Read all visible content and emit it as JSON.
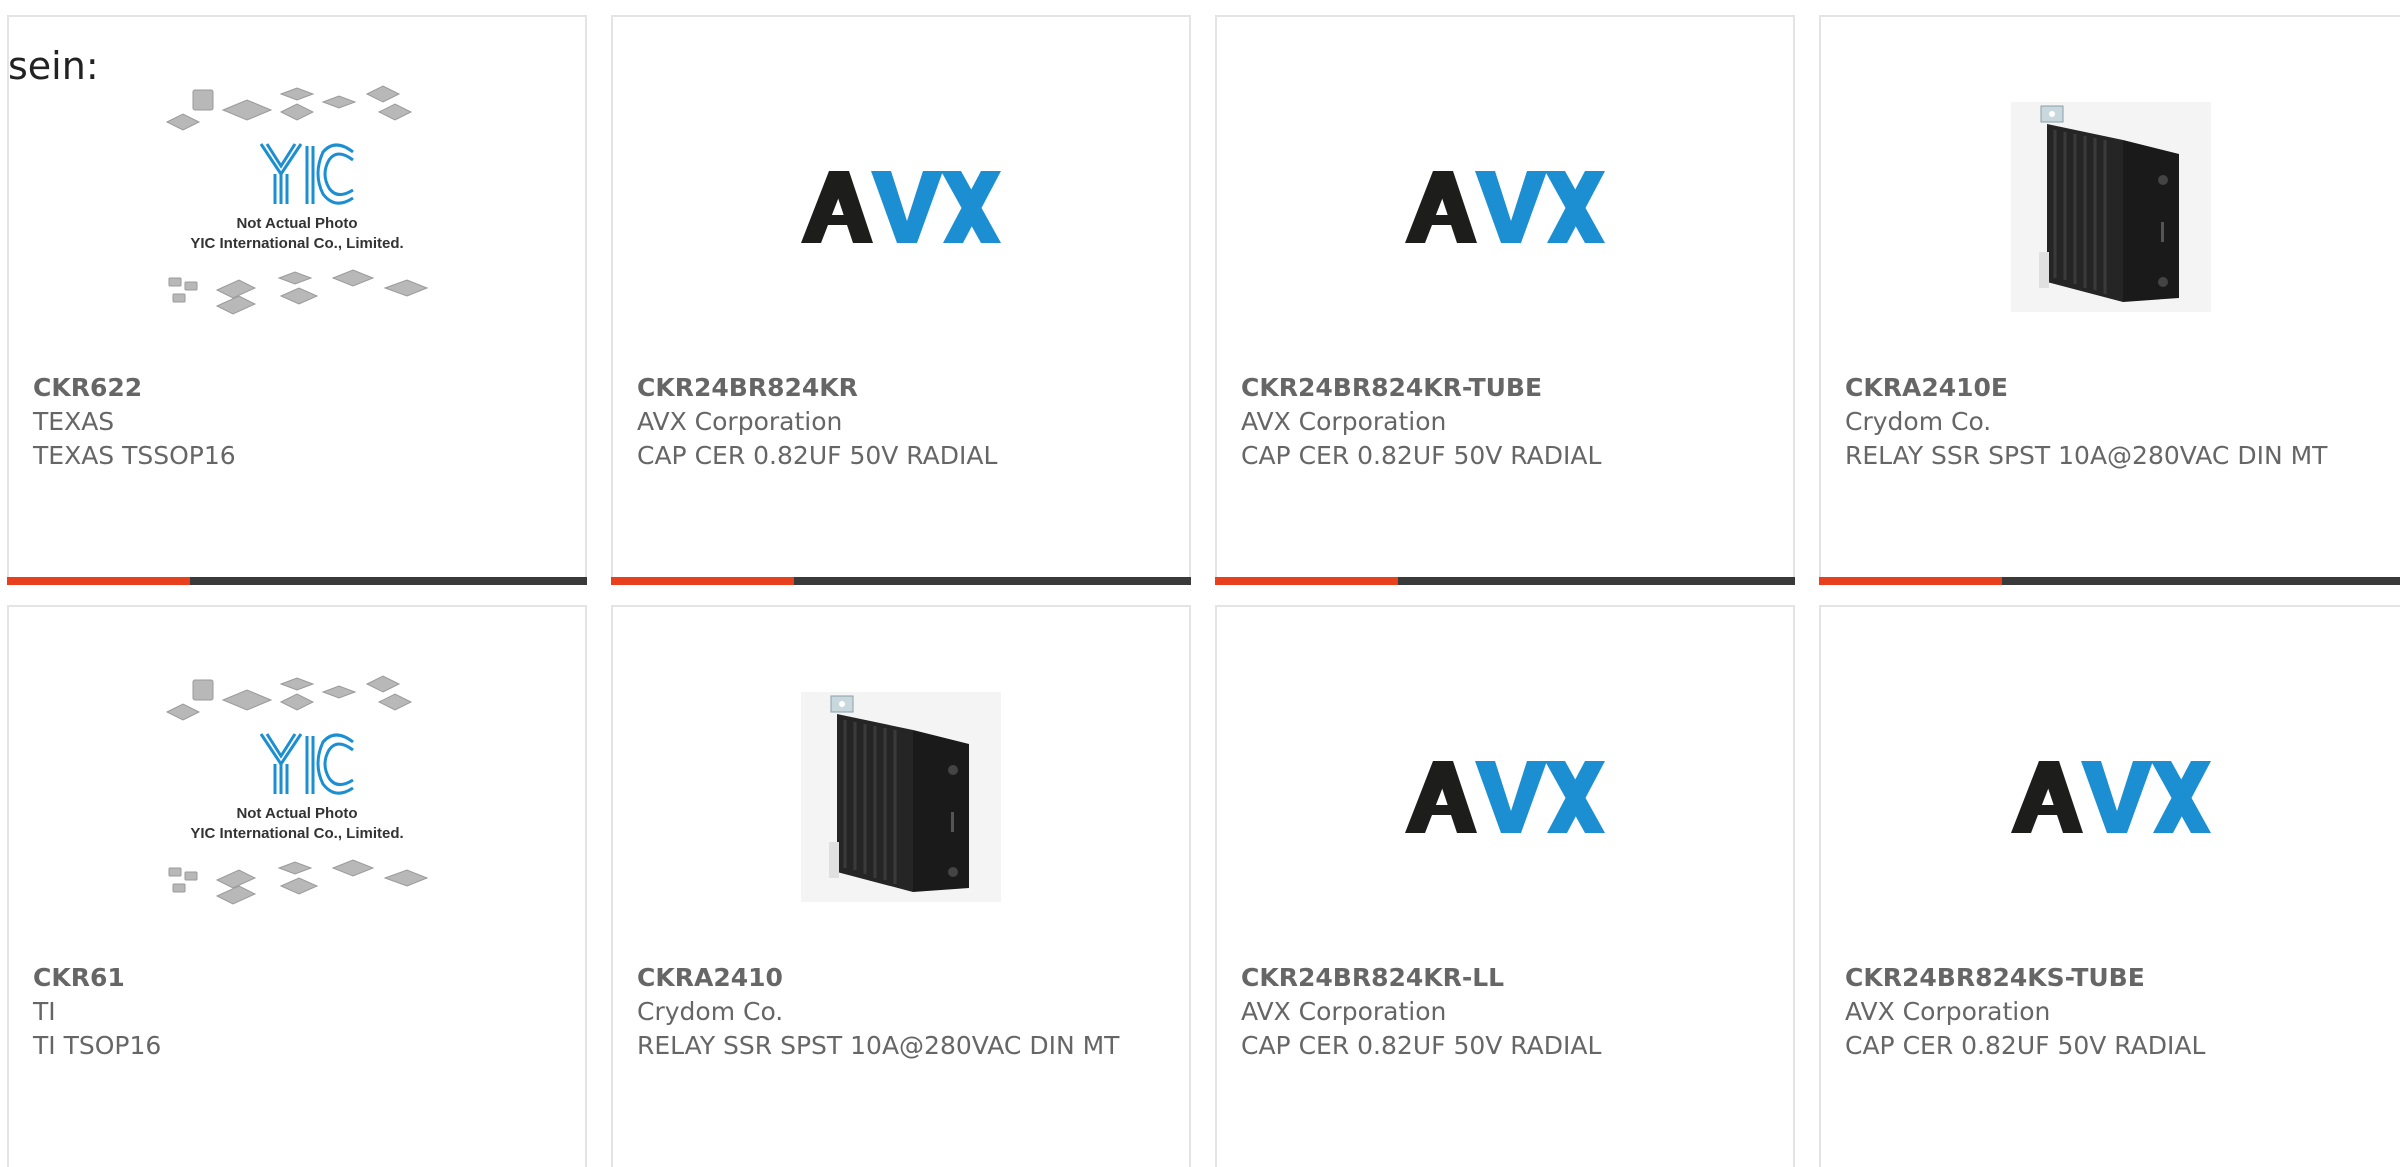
{
  "stray_text": "sein:",
  "colors": {
    "accent": "#e8401c",
    "dark_bar": "#3a3a3a",
    "card_border": "#e4e4e4",
    "text": "#666666",
    "avx_black": "#1d1d1b",
    "avx_blue": "#1b8fd2"
  },
  "placeholder_image": {
    "line1": "Not Actual Photo",
    "line2": "YIC International Co., Limited."
  },
  "products": [
    {
      "part_number": "CKR622",
      "manufacturer": "TEXAS",
      "description": "TEXAS TSSOP16",
      "image": "yic-placeholder"
    },
    {
      "part_number": "CKR24BR824KR",
      "manufacturer": "AVX Corporation",
      "description": "CAP CER 0.82UF 50V RADIAL",
      "image": "avx-logo"
    },
    {
      "part_number": "CKR24BR824KR-TUBE",
      "manufacturer": "AVX Corporation",
      "description": "CAP CER 0.82UF 50V RADIAL",
      "image": "avx-logo"
    },
    {
      "part_number": "CKRA2410E",
      "manufacturer": "Crydom Co.",
      "description": "RELAY SSR SPST 10A@280VAC DIN MT",
      "image": "relay-photo"
    },
    {
      "part_number": "CKR61",
      "manufacturer": "TI",
      "description": "TI TSOP16",
      "image": "yic-placeholder"
    },
    {
      "part_number": "CKRA2410",
      "manufacturer": "Crydom Co.",
      "description": "RELAY SSR SPST 10A@280VAC DIN MT",
      "image": "relay-photo"
    },
    {
      "part_number": "CKR24BR824KR-LL",
      "manufacturer": "AVX Corporation",
      "description": "CAP CER 0.82UF 50V RADIAL",
      "image": "avx-logo"
    },
    {
      "part_number": "CKR24BR824KS-TUBE",
      "manufacturer": "AVX Corporation",
      "description": "CAP CER 0.82UF 50V RADIAL",
      "image": "avx-logo"
    }
  ]
}
